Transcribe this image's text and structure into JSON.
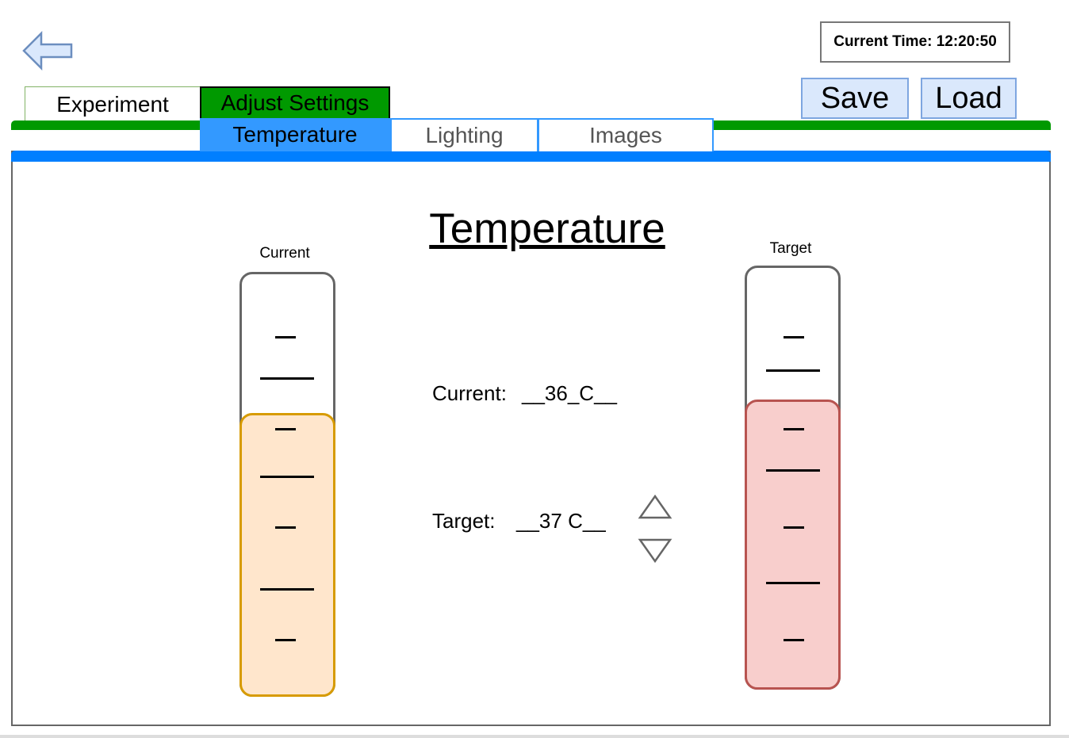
{
  "header": {
    "current_time": "Current Time: 12:20:50",
    "save_label": "Save",
    "load_label": "Load",
    "back_icon": "left-arrow-icon"
  },
  "tabs": {
    "main": [
      "Experiment",
      "Adjust Settings"
    ],
    "active_main": "Adjust Settings",
    "sub": [
      "Temperature",
      "Lighting",
      "Images"
    ],
    "active_sub": "Temperature"
  },
  "content": {
    "title": "Temperature",
    "current_gauge_label": "Current",
    "target_gauge_label": "Target",
    "current_label": "Current:",
    "current_value": "__36_C__",
    "target_label": "Target:",
    "target_value": "__37 C__",
    "increase_icon": "triangle-up-icon",
    "decrease_icon": "triangle-down-icon"
  },
  "colors": {
    "main_tab_active": "#009900",
    "sub_tab_active": "#3399ff",
    "current_fill": "#ffe6cc",
    "current_fill_border": "#d79b00",
    "target_fill": "#f8cecc",
    "target_fill_border": "#b85450",
    "button_bg": "#dae8fc",
    "button_border": "#7ea6e0"
  }
}
